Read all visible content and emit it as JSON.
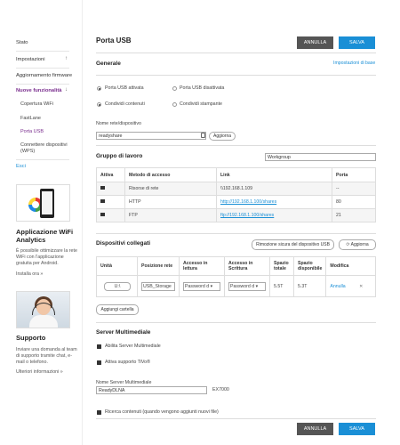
{
  "sidebar": {
    "items": [
      {
        "label": "Stato"
      },
      {
        "label": "Impostazioni",
        "arrow": "↑"
      },
      {
        "label": "Aggiornamento firmware"
      },
      {
        "label": "Nuove funzionalità",
        "arrow": "↓"
      }
    ],
    "subitems": [
      {
        "label": "Copertura WiFi"
      },
      {
        "label": "FastLane"
      },
      {
        "label": "Porta USB"
      },
      {
        "label": "Connettere dispositivi (WPS)"
      }
    ],
    "exit_label": "Esci",
    "app_title": "Applicazione WiFi Analytics",
    "app_text": "È possibile ottimizzare la rete WiFi con l'applicazione gratuita per Android.",
    "app_link": "Installa ora »",
    "support_title": "Supporto",
    "support_text": "Inviare una domanda al team di supporto tramite chat, e-mail o telefono.",
    "support_link": "Ulteriori informazioni »"
  },
  "header": {
    "title": "Porta USB",
    "cancel_label": "ANNULLA",
    "save_label": "SALVA"
  },
  "general": {
    "title": "Generale",
    "base_link": "Impostazioni di base",
    "opt_usb_on": "Porta USB attivata",
    "opt_usb_off": "Porta USB disattivata",
    "opt_share_content": "Condividi contenuti",
    "opt_share_printer": "Condividi stampante",
    "network_name_label": "Nome rete/dispositivo",
    "network_name_value": "readyshare",
    "update_label": "Aggiorna"
  },
  "workgroup": {
    "title": "Gruppo di lavoro",
    "input_value": "Workgroup",
    "headers": [
      "Attiva",
      "Metodo di accesso",
      "Link",
      "Porta"
    ],
    "rows": [
      {
        "method": "Risorse di rete",
        "link": "\\\\192.168.1.109",
        "port": "--"
      },
      {
        "method": "HTTP",
        "link": "http://192.168.1.100/shares",
        "port": "80"
      },
      {
        "method": "FTP",
        "link": "ftp://192.168.1.100/shares",
        "port": "21"
      }
    ]
  },
  "devices": {
    "title": "Dispositivi collegati",
    "remove_label": "Rimozione sicura del dispositivo USB",
    "refresh_label": "Aggiorna",
    "headers": [
      "Unità",
      "Posizione rete",
      "Accesso in lettura",
      "Accesso in Scrittura",
      "Spazio totale",
      "Spazio disponibile",
      "Modifica"
    ],
    "row": {
      "unit": "U:\\",
      "location": "USB_Storage",
      "read": "Password d",
      "write": "Password d",
      "total": "5.5T",
      "free": "5.3T",
      "edit": "Annulla",
      "delete": "✕"
    },
    "add_folder_label": "Aggiungi cartella"
  },
  "media": {
    "title": "Server Multimediale",
    "enable_label": "Abilita Server Multimediale",
    "tivo_label": "Attiva supporto TiVo®",
    "server_name_label": "Nome Server Multimediale",
    "server_name_value": "ReadyDLNA",
    "server_name_suffix": "EX7000",
    "rescan_label": "Ricerca contenuti (quando vengono aggiunti nuovi file)"
  },
  "footer": {
    "cancel_label": "ANNULLA",
    "save_label": "SALVA"
  },
  "colors": {
    "accent": "#1a8fd6",
    "active": "#7a2e8e",
    "dark_button": "#555555"
  }
}
